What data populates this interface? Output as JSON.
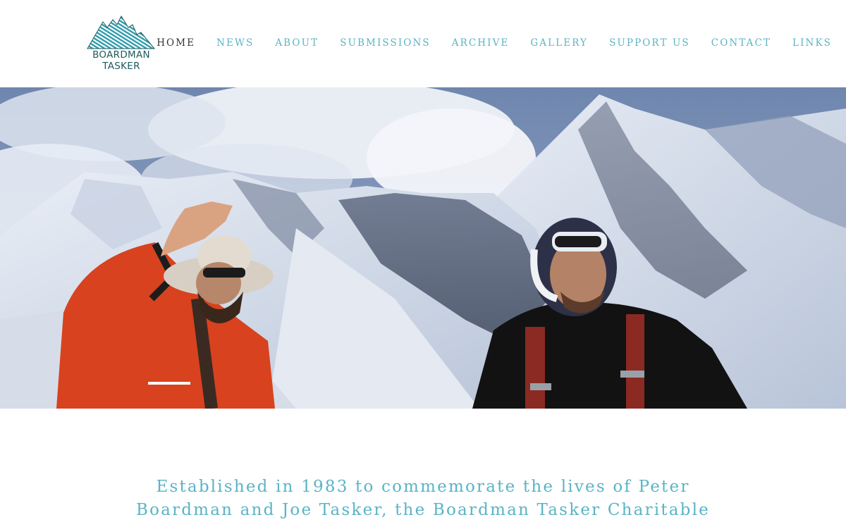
{
  "brand": {
    "line1": "BOARDMAN",
    "line2": "TASKER",
    "icon": "mountain-logo-icon",
    "color": "#1d5a5e",
    "accent": "#3aa3b3"
  },
  "nav": {
    "items": [
      {
        "label": "HOME",
        "active": true
      },
      {
        "label": "NEWS",
        "active": false
      },
      {
        "label": "ABOUT",
        "active": false
      },
      {
        "label": "SUBMISSIONS",
        "active": false
      },
      {
        "label": "ARCHIVE",
        "active": false
      },
      {
        "label": "GALLERY",
        "active": false
      },
      {
        "label": "SUPPORT US",
        "active": false
      },
      {
        "label": "CONTACT",
        "active": false
      },
      {
        "label": "LINKS",
        "active": false
      }
    ],
    "color": "#5ab4c6",
    "active_color": "#333333"
  },
  "hero": {
    "subject": "two mountaineers in front of snowy peaks"
  },
  "intro": {
    "text": "Established in 1983 to commemorate the lives of Peter Boardman and Joe Tasker, the Boardman Tasker Charitable"
  }
}
